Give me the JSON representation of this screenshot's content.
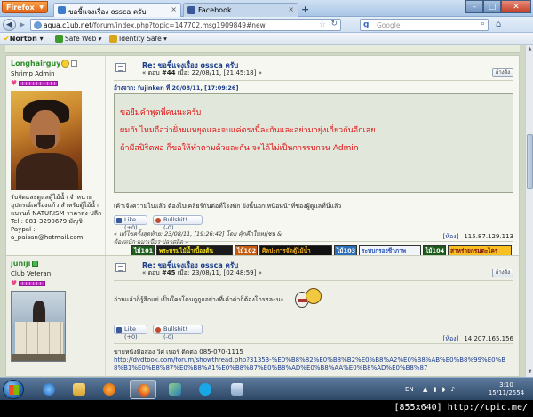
{
  "browser": {
    "app_button": "Firefox",
    "tabs": [
      {
        "label": "ขอชี้แจงเรื่อง ossca ครับ",
        "active": true
      },
      {
        "label": "Facebook",
        "active": false
      }
    ],
    "new_tab": "+",
    "url_domain": "aqua.c1ub.net",
    "url_path": "/forum/index.php?topic=147702.msg1909849#new",
    "search_placeholder": "Google",
    "norton": {
      "logo": "Norton",
      "safe_web": "Safe Web",
      "identity_safe": "Identity Safe"
    }
  },
  "topstrip": "  ",
  "posts": [
    {
      "username": "Longhairguy",
      "rank": "Shrimp Admin",
      "signature_text": "รับจัดและดูแลตู้ไม้น้ำ จำหน่ายอุปกรณ์เครื่องแก้ว สำหรับตู้ไม้น้ำแบรนด์ NATURISM ราคาส่ง-ปลีก Tel : 081-3290679 มัญชิ Paypal : a_paisan@hotmail.com",
      "title": "Re: ขอชี้แจงเรื่อง ossca ครับ",
      "meta_prefix": "« ตอบ",
      "post_no": "#44",
      "meta_date": "เมื่อ: 22/08/11, [21:45:18] »",
      "quote_button": "อ้างอิง",
      "quote_header": "อ้างจาก: fujinken ที่ 20/08/11, [17:09:26]",
      "quote_lines": [
        "ขอยืมคำพูดพี่คนนะครับ",
        "ผมกับไหมถือว่าฝั่งผมหยุดและจบแค่ตรงนี้ละกันและอย่ามายุ่งเกี่ยวกันอีกเลย",
        "ถ้ามีสปิริตพอ ก็ขอให้ทำตามด้วยละกัน จะได้ไม่เป็นการรบกวน Admin"
      ],
      "body": "เค้าเจ้งความไปแล้ว ต้องไปเคลียร์กันต่อที่โรงพัก ยังนี้นอกเหนือหน้าที่ของผู้ดูแลที่นี่แล้ว",
      "like": "Like (+0)",
      "bullshit": "Bullshit! (-0)",
      "edit_note_1": "« แก้ไขครั้งสุดท้าย: 23/08/11, [19:26:42] โดย คุ้กคีกในหมู่ชน &",
      "edit_note_2": "ต้องหนัก แมวเชียร ปลาสลิด »",
      "ip_label": "[ห้อง]",
      "ip": "115.87.129.113",
      "banners": [
        {
          "text": "พระบรมไม้น้ำเบื้องต้น",
          "bg": "#1b1b1b",
          "fg": "#f5e21a"
        },
        {
          "text": "ศิลปะการจัดตู้ไม้น้ำ",
          "bg": "#111111",
          "fg": "#f6b21b"
        },
        {
          "text": "ระบบกรองชีวภาพ",
          "bg": "#f1f4f8",
          "fg": "#2a55b6"
        },
        {
          "text": "สาหร่ายกรมตะไคร่",
          "bg": "#f8c020",
          "fg": "#7b1010"
        }
      ]
    },
    {
      "username": "juniji",
      "rank": "Club Veteran",
      "title": "Re: ขอชี้แจงเรื่อง ossca ครับ",
      "meta_prefix": "« ตอบ",
      "post_no": "#45",
      "meta_date": "เมื่อ: 23/08/11, [02:48:59] »",
      "quote_button": "อ้างอิง",
      "body": "อ่านแล้วก็รู้สึกแย่    เป็นใครโดนดูถูกอย่างที่เค้าด่าก็ต้องโกรธละนะ",
      "like": "Like (+0)",
      "bullshit": "Bullshit! (-0)",
      "ip_label": "[ห้อง]",
      "ip": "14.207.165.156",
      "sig_line": "ขายหนังมือสอง   วิศ เบอร์ ติดต่อ 085-070-1115",
      "sig_url": "http://dvdtook.com/forum/showthread.php?31353-%E0%B8%82%E0%B8%B2%E0%B8%A2%E0%B8%AB%E0%B8%99%E0%B8%B1%E0%B8%87%E0%B8%A1%E0%B8%B7%E0%B8%AD%E0%B8%AA%E0%B8%AD%E0%B8%87"
    }
  ],
  "taskbar": {
    "lang": "EN",
    "time": "3:10",
    "date": "15/11/2554"
  },
  "watermark": "[855x640] http://upic.me/"
}
